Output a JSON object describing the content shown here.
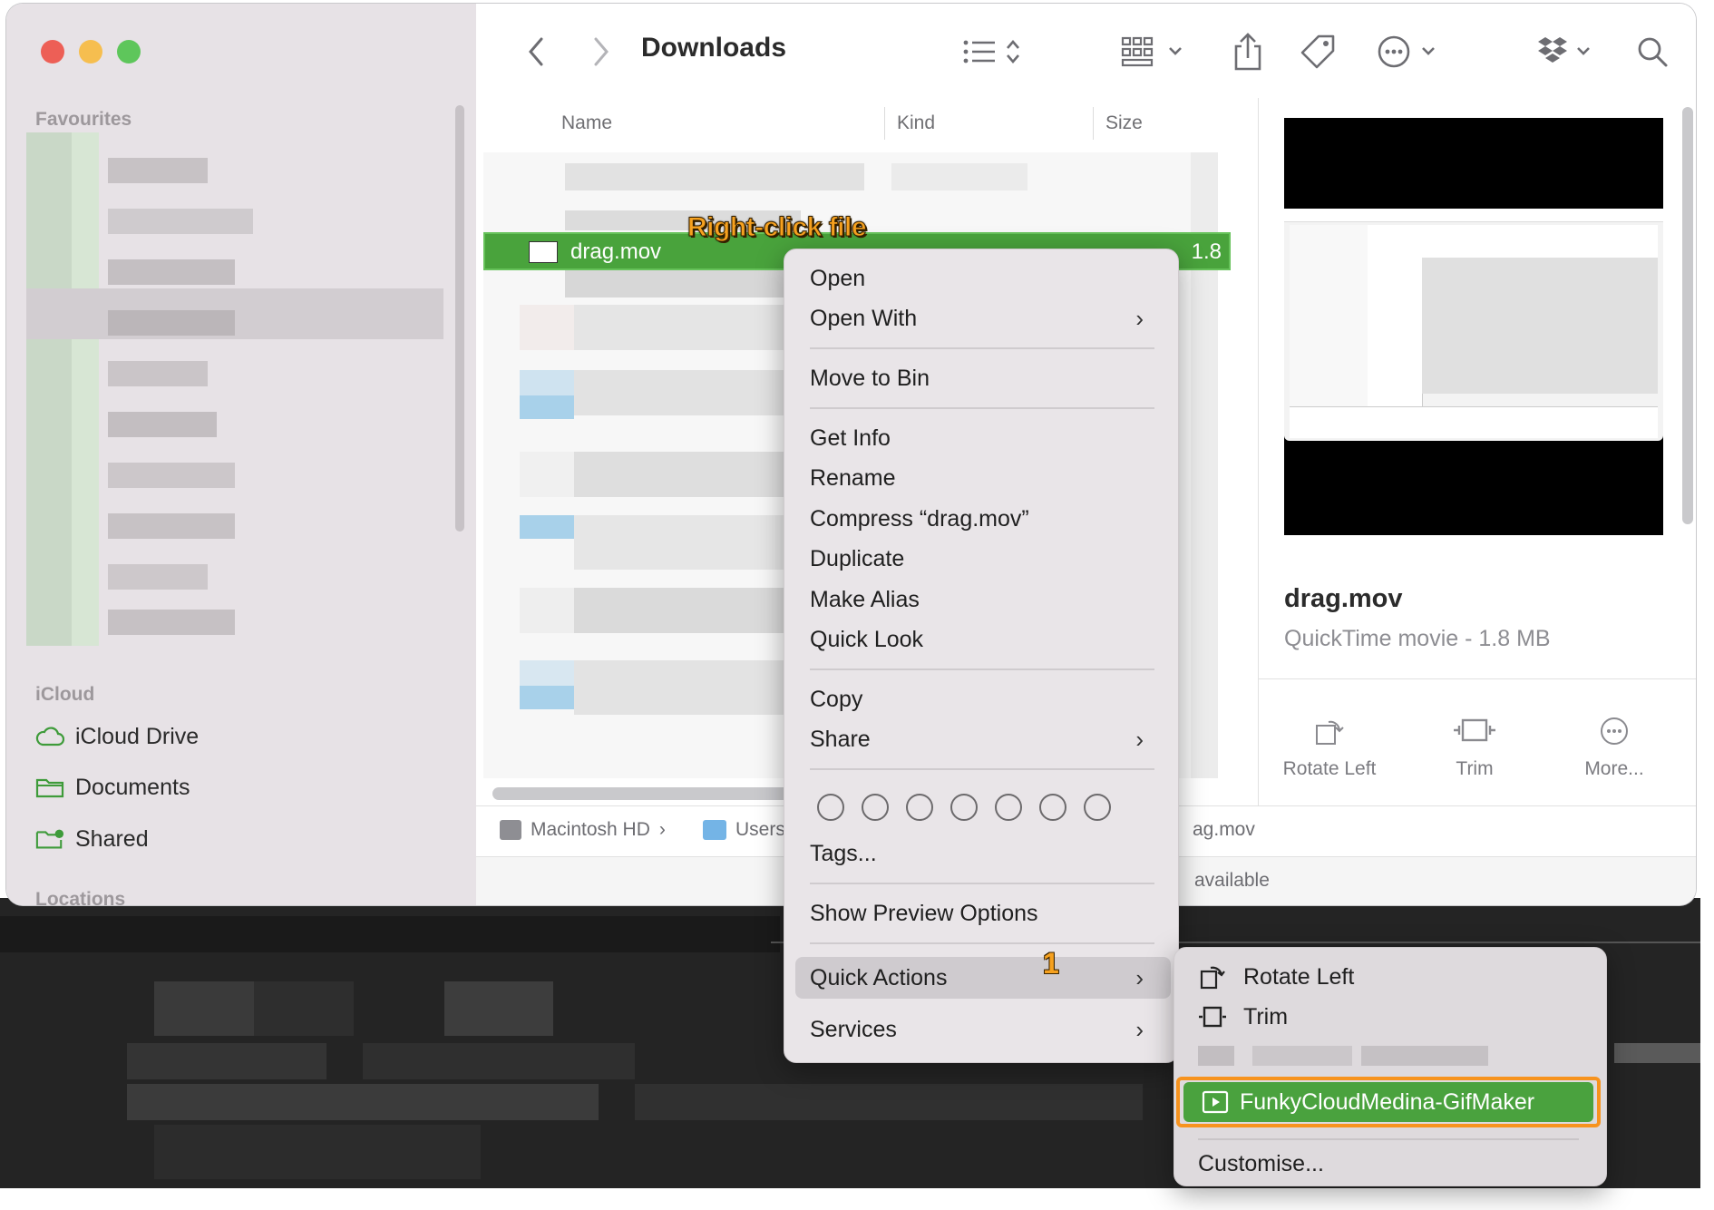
{
  "window": {
    "title": "Downloads"
  },
  "sidebar": {
    "sections": {
      "favourites": "Favourites",
      "icloud": "iCloud",
      "locations": "Locations"
    },
    "icloud_items": [
      {
        "label": "iCloud Drive",
        "icon": "cloud-icon"
      },
      {
        "label": "Documents",
        "icon": "folder-icon"
      },
      {
        "label": "Shared",
        "icon": "shared-folder-icon"
      }
    ]
  },
  "list": {
    "columns": [
      "Name",
      "Kind",
      "Size"
    ],
    "selected_file": {
      "name": "drag.mov",
      "size": "1.8"
    }
  },
  "preview": {
    "name": "drag.mov",
    "kind": "QuickTime movie - 1.8 MB",
    "actions": [
      "Rotate Left",
      "Trim",
      "More..."
    ]
  },
  "pathbar": {
    "items": [
      "Macintosh HD",
      "Users",
      "ag.mov"
    ]
  },
  "statusbar": {
    "text": "available"
  },
  "annotations": {
    "right_click": "Right-click file",
    "step": "1"
  },
  "context_menu": {
    "items": {
      "open": "Open",
      "open_with": "Open With",
      "move_to_bin": "Move to Bin",
      "get_info": "Get Info",
      "rename": "Rename",
      "compress": "Compress “drag.mov”",
      "duplicate": "Duplicate",
      "make_alias": "Make Alias",
      "quick_look": "Quick Look",
      "copy": "Copy",
      "share": "Share",
      "tags": "Tags...",
      "show_preview_options": "Show Preview Options",
      "quick_actions": "Quick Actions",
      "services": "Services"
    },
    "chevron": "›"
  },
  "quick_actions_submenu": {
    "rotate_left": "Rotate Left",
    "trim": "Trim",
    "gifmaker": "FunkyCloudMedina-GifMaker",
    "customise": "Customise..."
  },
  "colors": {
    "selection": "#4aa23e",
    "highlight_frame": "#f7931e",
    "annotation": "#f6a11f"
  }
}
